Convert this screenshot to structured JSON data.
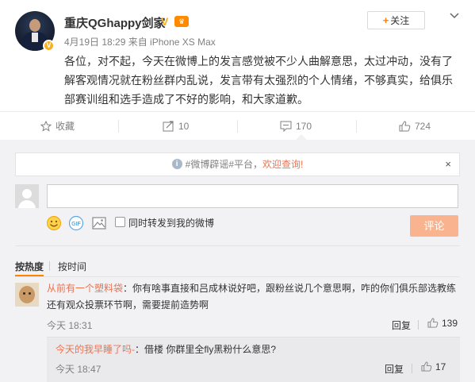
{
  "post": {
    "author_name": "重庆QGhappy剑家",
    "verified_icon": "v-verified-icon",
    "meta": "4月19日 18:29 来自 iPhone XS Max",
    "follow_label": "关注",
    "content": "各位，对不起，今天在微博上的发言感觉被不少人曲解意思，太过冲动，没有了解客观情况就在粉丝群内乱说，发言带有太强烈的个人情绪，不够真实，给俱乐部赛训组和选手造成了不好的影响，和大家道歉。"
  },
  "actions": {
    "favorite_label": "收藏",
    "repost_count": "10",
    "comment_count": "170",
    "like_count": "724"
  },
  "notice": {
    "prefix": "#微博辟谣#平台，",
    "link": "欢迎查询!",
    "close": "×"
  },
  "composer": {
    "input_value": "",
    "repost_label": "同时转发到我的微博",
    "submit_label": "评论"
  },
  "sort": {
    "by_hot": "按热度",
    "by_time": "按时间"
  },
  "comments": [
    {
      "user": "从前有一个塑料袋",
      "separator": "：",
      "text": "你有啥事直接和吕成林说好吧，跟粉丝说几个意思啊，咋的你们俱乐部选教练还有观众投票环节啊，需要提前造势啊",
      "time": "今天 18:31",
      "reply_label": "回复",
      "likes": "139",
      "replies": [
        {
          "user": "今天的我早睡了吗-",
          "separator": "：",
          "text": "借楼 你群里全fly黑粉什么意思?",
          "time": "今天 18:47",
          "reply_label": "回复",
          "likes": "17"
        }
      ]
    }
  ],
  "colors": {
    "accent": "#ff8200",
    "username": "#eb7350",
    "submit_disabled": "#f9b38f",
    "comment_bg": "#f2f2f5"
  }
}
